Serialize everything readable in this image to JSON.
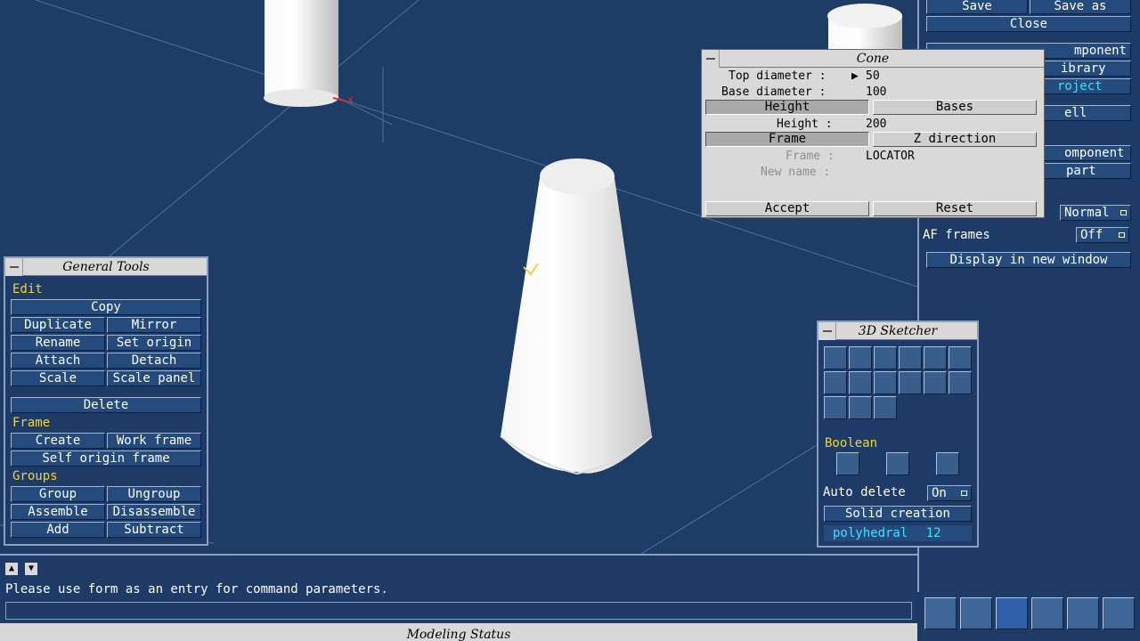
{
  "viewport": {
    "axis_marker": "x"
  },
  "cone_form": {
    "title": "Cone",
    "top_diameter_label": "Top diameter :",
    "top_diameter_value": "50",
    "base_diameter_label": "Base diameter :",
    "base_diameter_value": "100",
    "height_button": "Height",
    "bases_button": "Bases",
    "height_label": "Height :",
    "height_value": "200",
    "frame_button": "Frame",
    "z_direction_button": "Z direction",
    "frame_label": "Frame :",
    "frame_value": "LOCATOR",
    "new_name_label": "New name :",
    "accept_button": "Accept",
    "reset_button": "Reset"
  },
  "right_panel": {
    "save_button": "Save",
    "save_as_button": "Save as",
    "close_button": "Close",
    "item_component": "mponent",
    "item_library": "ibrary",
    "item_project": "roject",
    "item_cell": "ell",
    "item_component2": "omponent",
    "item_part": "part",
    "normal_option": "Normal",
    "af_frames_label": "AF frames",
    "af_frames_option": "Off",
    "display_new_window": "Display in new window"
  },
  "general_tools": {
    "title": "General Tools",
    "edit_section": "Edit",
    "copy": "Copy",
    "duplicate": "Duplicate",
    "mirror": "Mirror",
    "rename": "Rename",
    "set_origin": "Set origin",
    "attach": "Attach",
    "detach": "Detach",
    "scale": "Scale",
    "scale_panel": "Scale panel",
    "delete": "Delete",
    "frame_section": "Frame",
    "create": "Create",
    "work_frame": "Work frame",
    "self_origin_frame": "Self origin frame",
    "groups_section": "Groups",
    "group": "Group",
    "ungroup": "Ungroup",
    "assemble": "Assemble",
    "disassemble": "Disassemble",
    "add": "Add",
    "subtract": "Subtract"
  },
  "sketcher": {
    "title": "3D Sketcher",
    "boolean_section": "Boolean",
    "auto_delete_label": "Auto delete",
    "auto_delete_option": "On",
    "solid_creation": "Solid creation",
    "polyhedral_label": "polyhedral",
    "polyhedral_value": "12",
    "icons": [
      "cube-icon",
      "box-icon",
      "extrude-icon",
      "wedge-icon",
      "cylinder-icon",
      "tube-icon",
      "sphere-icon",
      "cone-icon",
      "pyramid-icon",
      "prism-icon",
      "sweep-icon",
      "revolve-icon",
      "brush-icon",
      "torus-icon",
      "ring-icon",
      "union-icon",
      "intersect-icon",
      "difference-icon"
    ]
  },
  "command": {
    "message": "Please use form as an entry for command parameters."
  },
  "status_bar": {
    "title": "Modeling Status"
  },
  "colors": {
    "background": "#1d3c66",
    "accent_yellow": "#f0d33a",
    "cyan_text": "#40e0ff"
  }
}
